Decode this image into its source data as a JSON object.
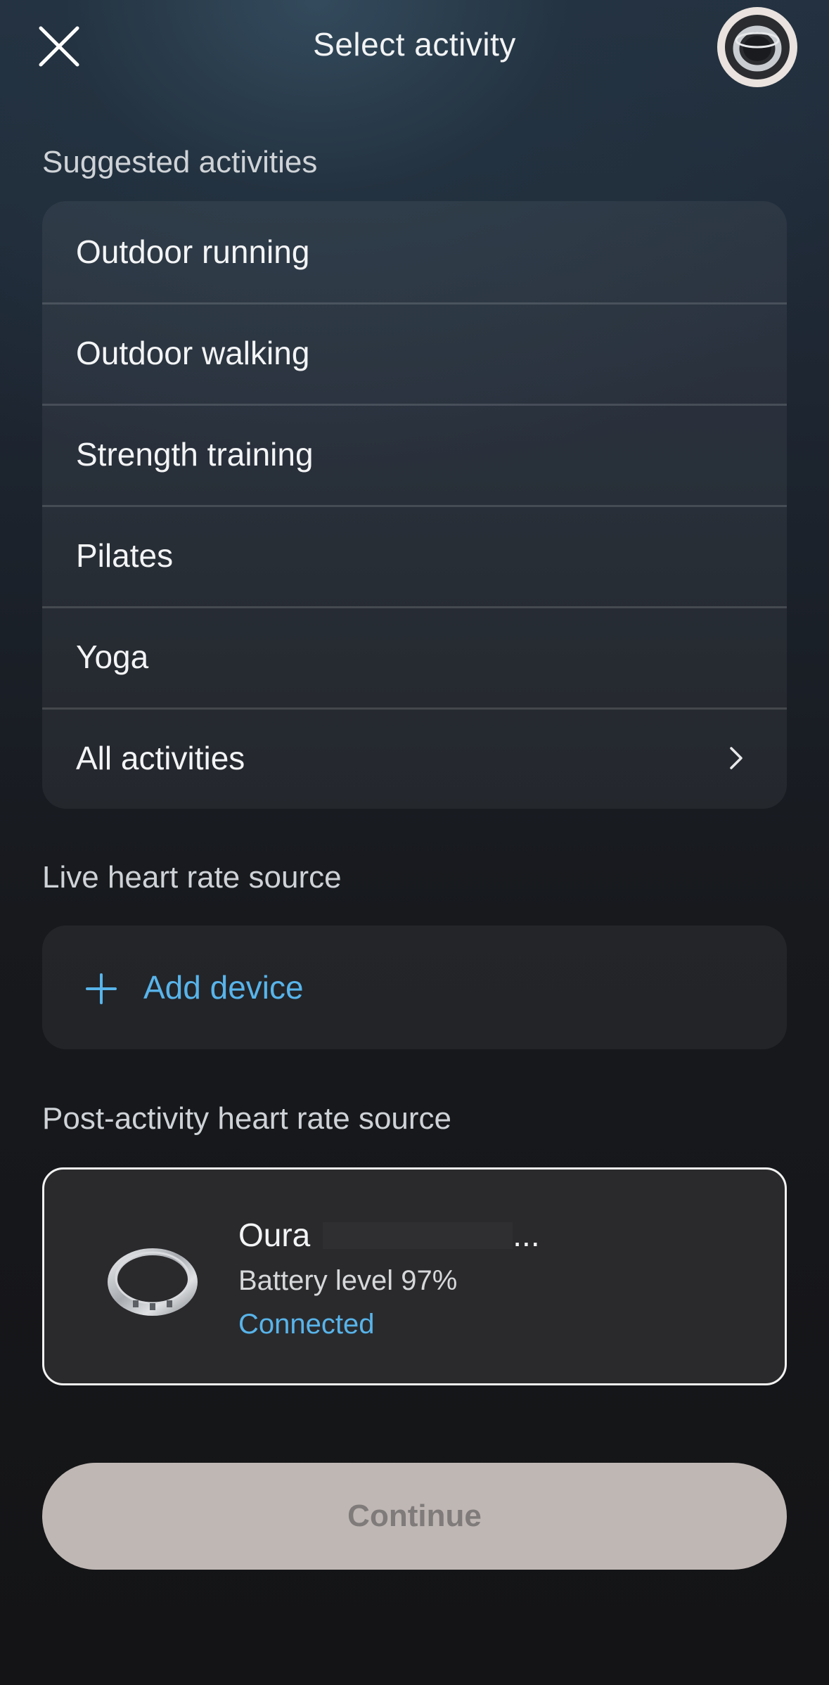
{
  "header": {
    "title": "Select activity",
    "close_icon": "close-icon",
    "ring_icon": "ring-device-icon"
  },
  "suggested": {
    "heading": "Suggested activities",
    "items": [
      {
        "label": "Outdoor running"
      },
      {
        "label": "Outdoor walking"
      },
      {
        "label": "Strength training"
      },
      {
        "label": "Pilates"
      },
      {
        "label": "Yoga"
      },
      {
        "label": "All activities",
        "icon": "chevron-right-icon"
      }
    ]
  },
  "live_source": {
    "heading": "Live heart rate source",
    "add_label": "Add device",
    "add_icon": "plus-icon"
  },
  "post_source": {
    "heading": "Post-activity heart rate source",
    "device": {
      "name": "Oura",
      "name_suffix": "...",
      "battery": "Battery level 97%",
      "status": "Connected"
    }
  },
  "actions": {
    "continue_label": "Continue"
  },
  "colors": {
    "accent": "#58b4ea",
    "button_bg": "#bfb7b4",
    "button_text": "#7f7b7a",
    "card_border": "#f2f2f2"
  }
}
